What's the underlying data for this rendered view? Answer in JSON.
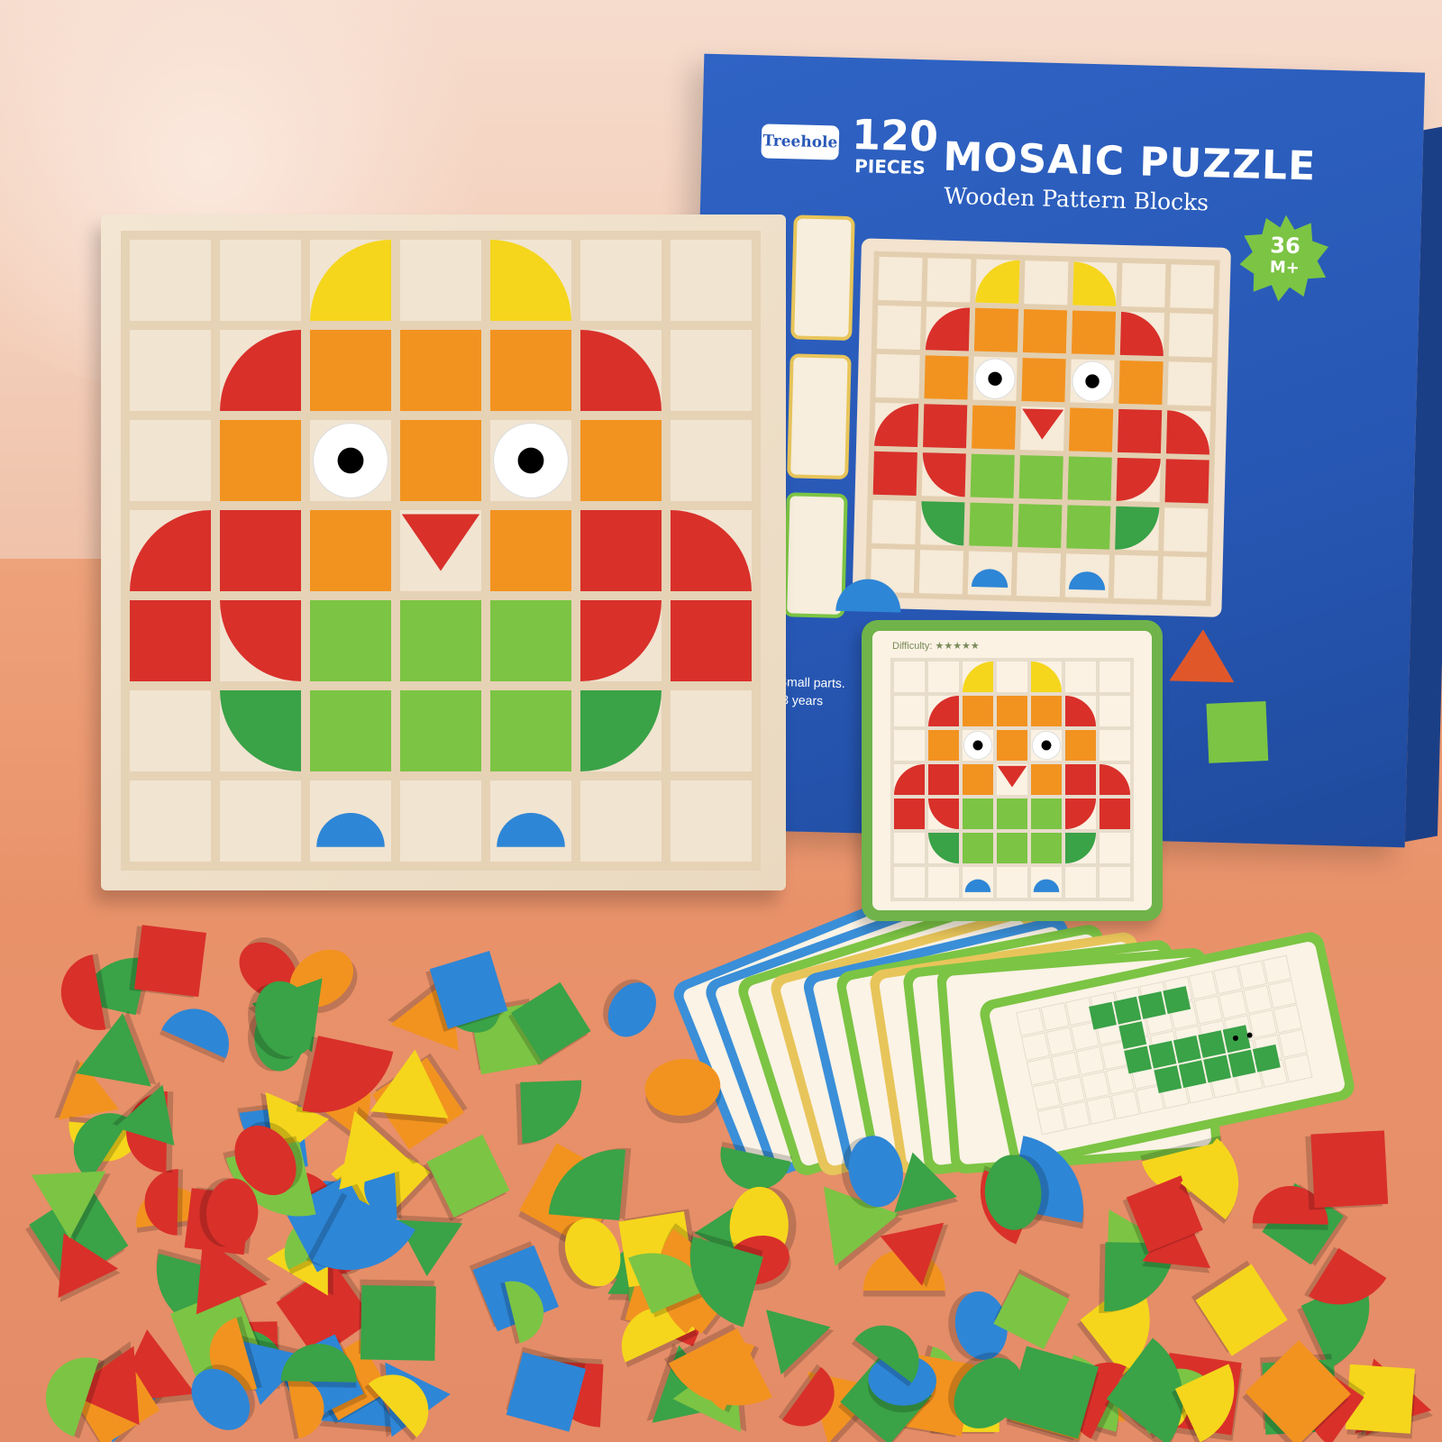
{
  "box": {
    "brand": "Treehole",
    "pieces_count": "120",
    "pieces_label": "PIECES",
    "title": "MOSAIC PUZZLE",
    "subtitle": "Wooden Pattern Blocks",
    "age_number": "36",
    "age_unit": "M+",
    "warning_line1": "-Small parts.",
    "warning_line2": "r 3 years"
  },
  "reference_card": {
    "difficulty_label": "Difficulty: ★★★★★"
  },
  "colors": {
    "box_blue": "#2a5cbc",
    "board_wood": "#efe0c9",
    "yellow": "#f5d61c",
    "orange": "#f29320",
    "red": "#d9302a",
    "green_light": "#7cc444",
    "green_dark": "#3aa247",
    "blue": "#2e86d6",
    "eye_white": "#ffffff"
  },
  "owl_pattern": {
    "grid_size": 7,
    "cells": [
      [
        "",
        "",
        "Yq-l",
        "",
        "Yq-r",
        "",
        ""
      ],
      [
        "",
        "Rq-l",
        "O",
        "O",
        "O",
        "Rq-r",
        ""
      ],
      [
        "",
        "O",
        "E",
        "O",
        "E",
        "O",
        ""
      ],
      [
        "Rq-l2",
        "R",
        "O",
        "Rt",
        "O",
        "R",
        "Rq-r2"
      ],
      [
        "R",
        "Rq-b",
        "G",
        "G",
        "G",
        "Rq-b2",
        "R"
      ],
      [
        "",
        "Dq-l",
        "G",
        "G",
        "G",
        "Dq-r",
        ""
      ],
      [
        "",
        "",
        "Bh",
        "",
        "Bh",
        "",
        ""
      ]
    ]
  }
}
